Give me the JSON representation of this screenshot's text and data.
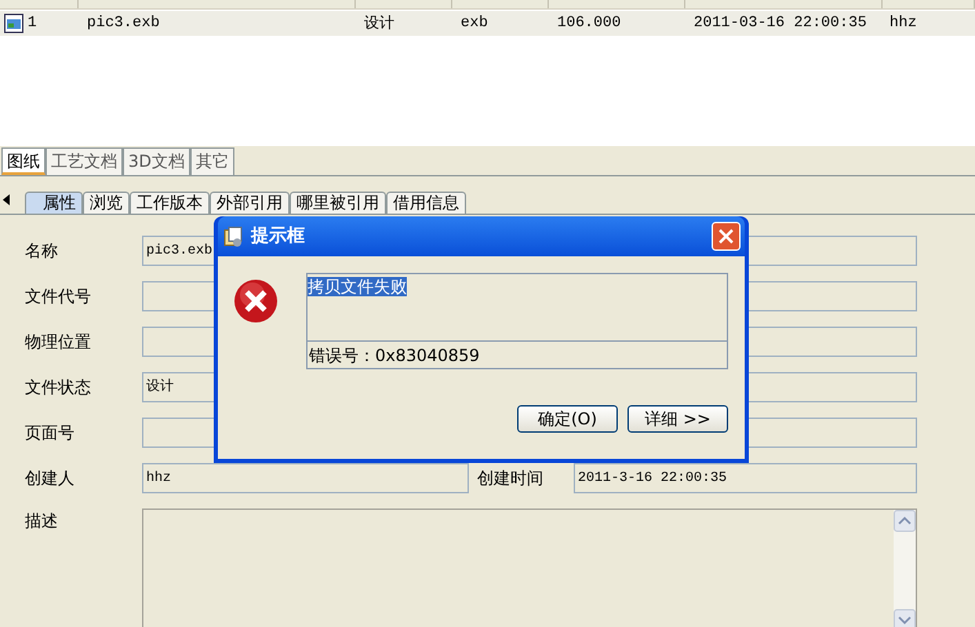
{
  "file_list": {
    "rows": [
      {
        "index": "1",
        "name": "pic3.exb",
        "status": "设计",
        "type": "exb",
        "size": "106.000",
        "created": "2011-03-16 22:00:35",
        "creator": "hhz",
        "selected": true
      }
    ]
  },
  "doc_tabs": [
    {
      "label": "图纸",
      "selected": true
    },
    {
      "label": "工艺文档",
      "selected": false
    },
    {
      "label": "3D文档",
      "selected": false
    },
    {
      "label": "其它",
      "selected": false
    }
  ],
  "sub_tabs": [
    {
      "label": "属性",
      "selected": true
    },
    {
      "label": "浏览",
      "selected": false
    },
    {
      "label": "工作版本",
      "selected": false
    },
    {
      "label": "外部引用",
      "selected": false
    },
    {
      "label": "哪里被引用",
      "selected": false
    },
    {
      "label": "借用信息",
      "selected": false
    }
  ],
  "form": {
    "fields": [
      {
        "label": "名称",
        "value": "pic3.exb"
      },
      {
        "label": "文件代号"
      },
      {
        "label": "物理位置"
      },
      {
        "label": "文件状态",
        "value": "设计"
      },
      {
        "label": "页面号"
      }
    ],
    "creator": {
      "label": "创建人",
      "value": "hhz"
    },
    "created": {
      "label": "创建时间",
      "value": "2011-3-16 22:00:35"
    },
    "description": {
      "label": "描述"
    }
  },
  "dialog": {
    "title": "提示框",
    "message": "拷贝文件失败",
    "error_code": "错误号：0x83040859",
    "buttons": [
      {
        "label": "确定(O)"
      },
      {
        "label": "详细 >>"
      }
    ]
  }
}
